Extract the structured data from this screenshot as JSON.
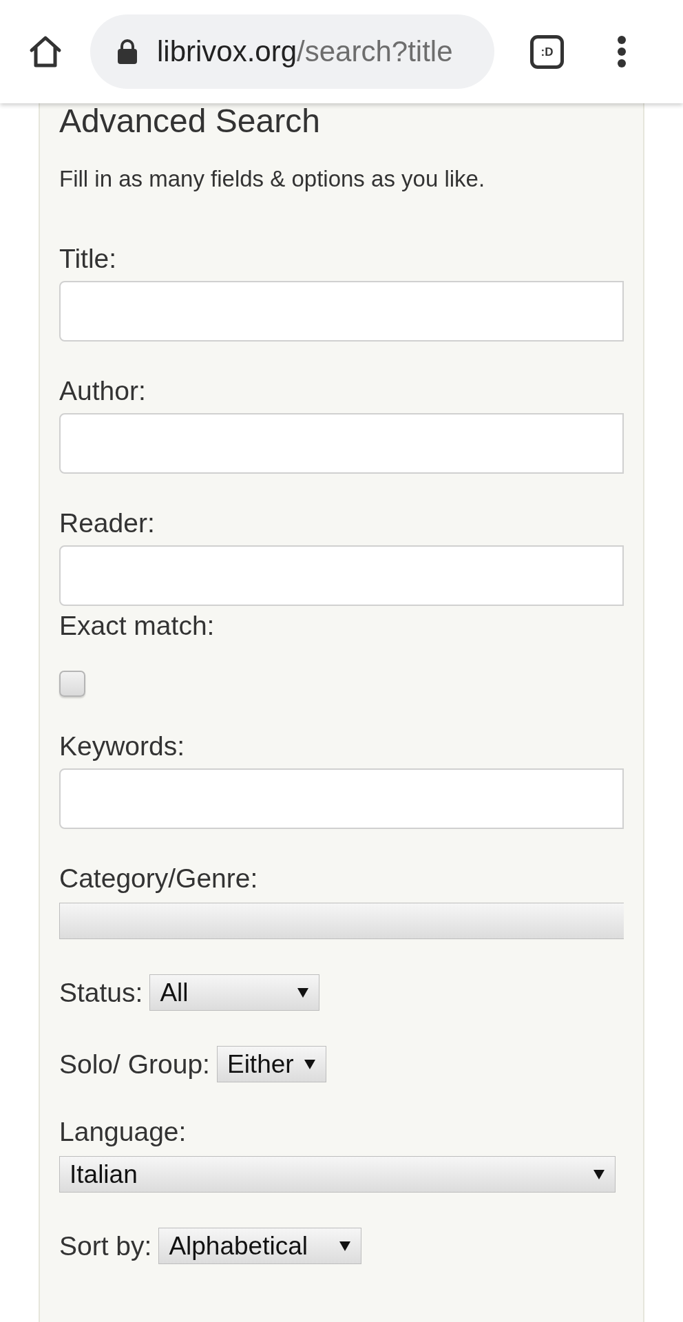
{
  "browser_bar": {
    "url_host": "librivox.org",
    "url_path": "/search?title",
    "tab_count": ":D"
  },
  "form": {
    "title": "Advanced Search",
    "intro": "Fill in as many fields & options as you like.",
    "fields": [
      {
        "kind": "text",
        "label": "Title:"
      },
      {
        "kind": "text",
        "label": "Author:"
      },
      {
        "kind": "text",
        "label": "Reader:"
      },
      {
        "kind": "checkbox",
        "label": "Exact match:",
        "checked": false
      },
      {
        "kind": "text",
        "label": "Keywords:"
      },
      {
        "kind": "select",
        "label": "Category/Genre:"
      },
      {
        "kind": "inline_select",
        "label": "Status:",
        "value": "All"
      },
      {
        "kind": "inline_select",
        "label": "Solo/ Group:",
        "value": "Either"
      },
      {
        "kind": "select",
        "label": "Language:",
        "value": "Italian"
      },
      {
        "kind": "inline_select",
        "label": "Sort by:",
        "value": "Alphabetical"
      }
    ]
  }
}
